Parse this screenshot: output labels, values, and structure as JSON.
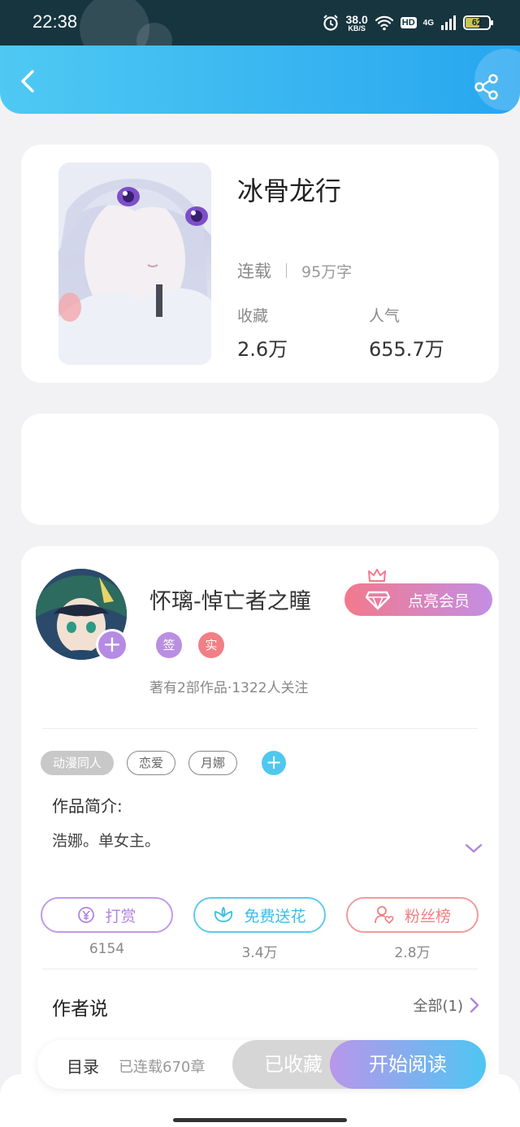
{
  "status_bar": {
    "time": "22:38",
    "net_speed_value": "38.0",
    "net_speed_unit": "KB/S",
    "hd_label": "HD",
    "network_label": "4G",
    "battery_level": "62"
  },
  "header": {
    "back_icon": "chevron-left-icon",
    "share_icon": "share-icon"
  },
  "book": {
    "title": "冰骨龙行",
    "status": "连载",
    "word_count": "95万字",
    "favorites_label": "收藏",
    "favorites_value": "2.6万",
    "popularity_label": "人气",
    "popularity_value": "655.7万"
  },
  "author": {
    "name": "怀璃-悼亡者之瞳",
    "badge_sign": "签",
    "badge_real": "实",
    "meta": "著有2部作品·1322人关注",
    "vip_button": "点亮会员"
  },
  "tags": [
    "动漫同人",
    "恋爱",
    "月娜"
  ],
  "intro": {
    "label": "作品简介:",
    "text": "浩娜。单女主。"
  },
  "actions": [
    {
      "label": "打赏",
      "count": "6154",
      "icon": "yen-coin-icon"
    },
    {
      "label": "免费送花",
      "count": "3.4万",
      "icon": "flower-icon"
    },
    {
      "label": "粉丝榜",
      "count": "2.8万",
      "icon": "fan-heart-icon"
    }
  ],
  "author_says": {
    "label": "作者说",
    "all_link": "全部(1)"
  },
  "bottom_bar": {
    "toc": "目录",
    "chapters": "已连载670章",
    "collected": "已收藏",
    "start_reading": "开始阅读"
  },
  "colors": {
    "accent_blue": "#27a6ef",
    "accent_purple": "#b68be6",
    "vip_pink": "#f3798c"
  }
}
